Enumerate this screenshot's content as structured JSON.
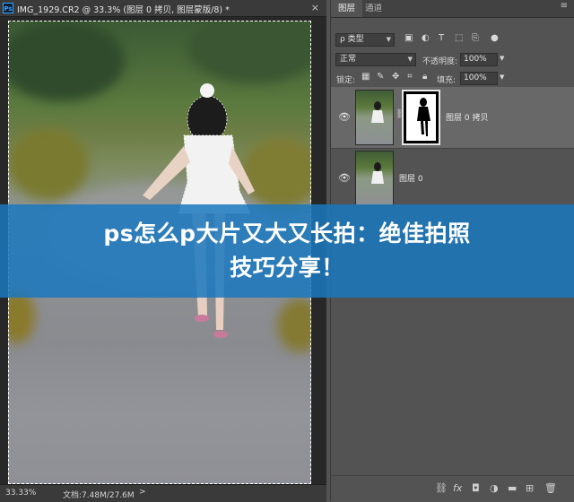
{
  "document": {
    "app_badge": "Ps",
    "tab_title": "IMG_1929.CR2 @ 33.3% (图层 0 拷贝, 图层蒙版/8) *",
    "close_glyph": "×",
    "zoom": "33.33%",
    "doc_size": "文档:7.48M/27.6M",
    "status_arrow": ">"
  },
  "panel": {
    "tabs": [
      "图层",
      "通道"
    ],
    "menu_glyph": "≡",
    "filter": {
      "label": "ρ 类型",
      "icons": [
        "image-filter-icon",
        "adjustment-filter-icon",
        "type-filter-icon",
        "shape-filter-icon",
        "smart-object-filter-icon",
        "filter-toggle-icon"
      ]
    },
    "blend_mode": "正常",
    "opacity_label": "不透明度:",
    "opacity_value": "100%",
    "lock_label": "锁定:",
    "fill_label": "填充:",
    "fill_value": "100%",
    "layers": [
      {
        "name": "图层 0 拷贝",
        "selected": true,
        "has_mask": true
      },
      {
        "name": "图层 0",
        "selected": false,
        "has_mask": false
      }
    ],
    "bottom_icons": [
      "link-layers-icon",
      "fx-icon",
      "add-mask-icon",
      "adjustment-layer-icon",
      "group-icon",
      "new-layer-icon",
      "delete-icon"
    ]
  },
  "overlay": {
    "line1": "ps怎么p大片又大又长拍：绝佳拍照",
    "line2": "技巧分享！"
  },
  "colors": {
    "banner": "#1a78be",
    "ps_blue": "#2fa4ff",
    "selected_layer": "#686868"
  }
}
